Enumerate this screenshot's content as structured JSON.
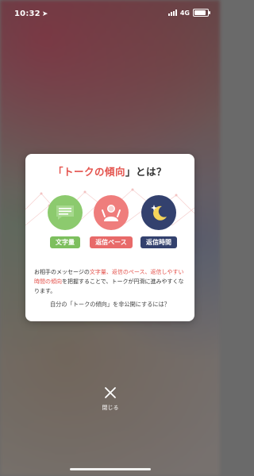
{
  "status_bar": {
    "time": "10:32",
    "network": "4G",
    "battery_level": 0.75
  },
  "modal": {
    "title_prefix": "「",
    "title_highlight": "トークの傾向",
    "title_suffix": "」とは？",
    "features": [
      {
        "icon": "text-lines-icon",
        "label": "文字量",
        "color": "#8cca6e"
      },
      {
        "icon": "person-waving-icon",
        "label": "返信ペース",
        "color": "#ef7d7c"
      },
      {
        "icon": "moon-star-icon",
        "label": "返信時間",
        "color": "#33416e"
      }
    ],
    "description": {
      "part1": "お相手のメッセージの",
      "highlight": "文字量、返信のペース、返信しやすい時間の傾向",
      "part2": "を把握することで、トークが円滑に進みやすくなります。"
    },
    "private_link": "自分の「トークの傾向」を非公開にするには？"
  },
  "close": {
    "label": "閉じる"
  },
  "colors": {
    "accent": "#e4534d",
    "green": "#8cca6e",
    "pink": "#ef7d7c",
    "navy": "#33416e"
  }
}
